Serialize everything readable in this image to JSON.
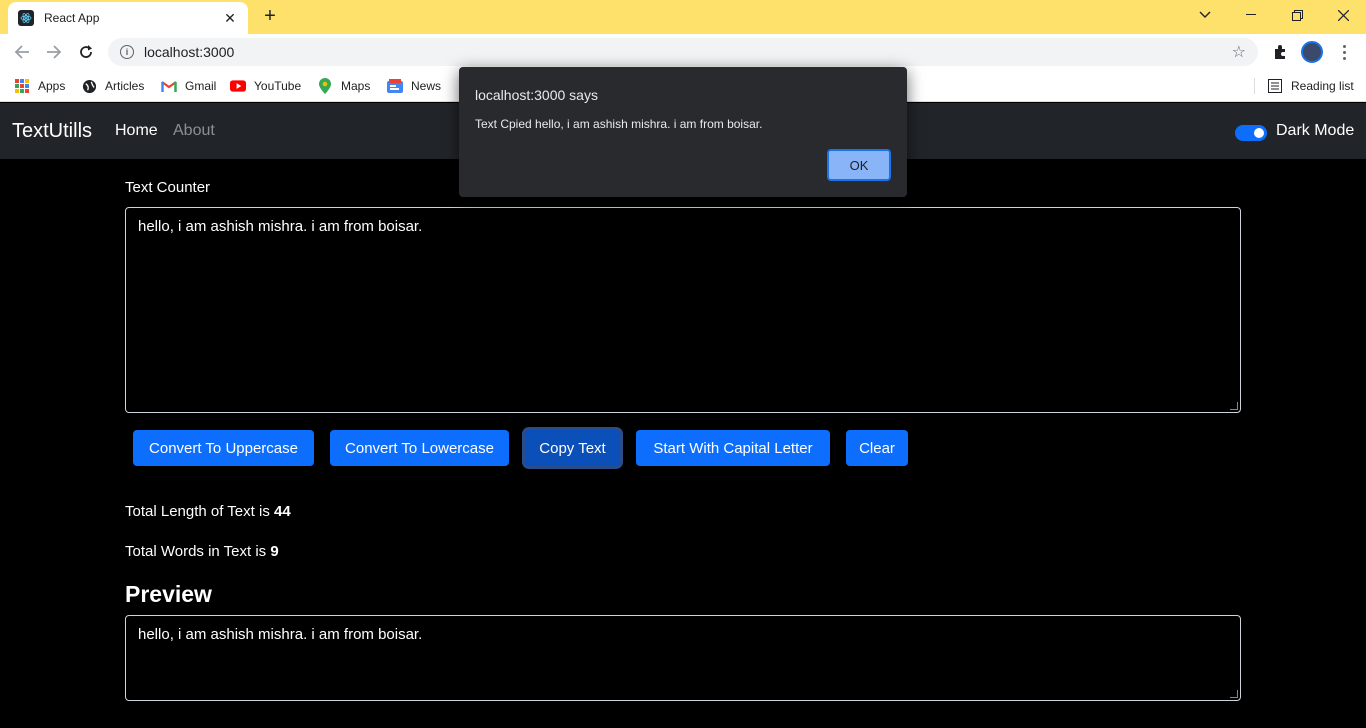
{
  "browser": {
    "tab_title": "React App",
    "url": "localhost:3000",
    "bookmarks": [
      "Apps",
      "Articles",
      "Gmail",
      "YouTube",
      "Maps",
      "News"
    ],
    "reading_list": "Reading list"
  },
  "navbar": {
    "brand": "TextUtills",
    "links": [
      "Home",
      "About"
    ],
    "dark_mode_label": "Dark Mode"
  },
  "main": {
    "heading": "Text Counter",
    "text": "hello, i am ashish mishra. i am from boisar.",
    "buttons": [
      "Convert To Uppercase",
      "Convert To Lowercase",
      "Copy Text",
      "Start With Capital Letter",
      "Clear"
    ],
    "length_label": "Total Length of Text is ",
    "length_value": "44",
    "words_label": "Total Words in Text is ",
    "words_value": "9",
    "preview_heading": "Preview",
    "preview_text": "hello, i am ashish mishra. i am from boisar."
  },
  "dialog": {
    "title": "localhost:3000 says",
    "message": "Text Cpied hello, i am ashish mishra. i am from boisar.",
    "ok_label": "OK"
  },
  "colors": {
    "titlebar": "#fde16a",
    "navbar": "#212529",
    "primary": "#0d6efd",
    "background": "#000000"
  }
}
